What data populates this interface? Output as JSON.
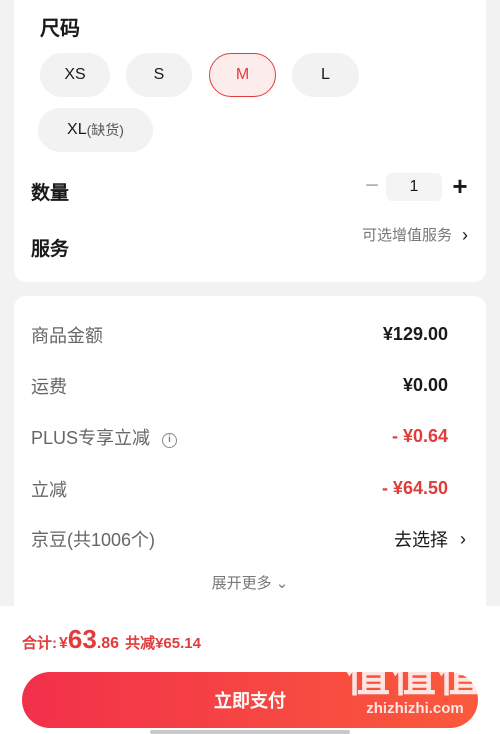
{
  "size": {
    "title": "尺码",
    "options": [
      {
        "label": "XS",
        "note": "",
        "selected": false
      },
      {
        "label": "S",
        "note": "",
        "selected": false
      },
      {
        "label": "M",
        "note": "",
        "selected": true
      },
      {
        "label": "L",
        "note": "",
        "selected": false
      },
      {
        "label": "XL",
        "note": "(缺货)",
        "selected": false
      }
    ]
  },
  "quantity": {
    "label": "数量",
    "minus": "−",
    "value": "1",
    "plus": "+"
  },
  "service": {
    "label": "服务",
    "link": "可选增值服务",
    "chevron": "›"
  },
  "fees": {
    "goods_label": "商品金额",
    "goods_value": "¥129.00",
    "shipping_label": "运费",
    "shipping_value": "¥0.00",
    "plus_label": "PLUS专享立减",
    "plus_info_icon": "i",
    "plus_value": "- ¥0.64",
    "discount_label": "立减",
    "discount_value": "- ¥64.50",
    "beans_label": "京豆(共1006个)",
    "beans_link": "去选择",
    "beans_chevron": "›",
    "expand_more": "展开更多 ⌄"
  },
  "bottom": {
    "total_label": "合计:",
    "currency": "¥",
    "total_int": "63",
    "total_dec": ".86",
    "saved": "共减¥65.14",
    "pay_button": "立即支付",
    "watermark_logo": "值值值",
    "watermark_text": "zhizhizhi.com"
  },
  "colors": {
    "accent": "#e23b3b",
    "pay_gradient_start": "#f2304a",
    "pay_gradient_end": "#fa5a3c",
    "page_bg": "#f2f2f2"
  }
}
